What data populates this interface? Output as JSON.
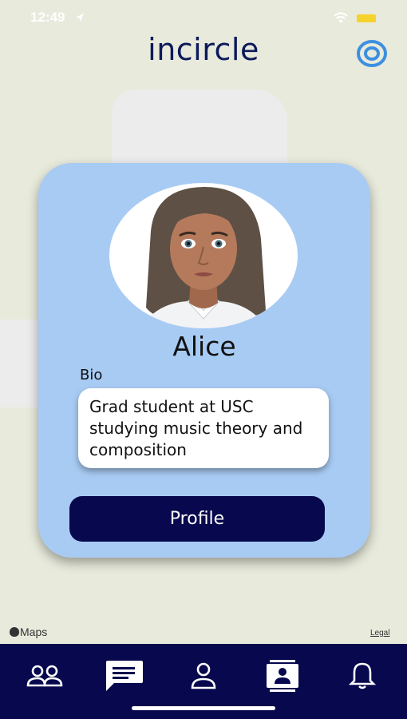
{
  "status_bar": {
    "time": "12:49"
  },
  "header": {
    "title": "incircle"
  },
  "card": {
    "name": "Alice",
    "bio_label": "Bio",
    "bio_text": "Grad student at USC studying music theory and composition",
    "profile_button": "Profile"
  },
  "map": {
    "attribution": "Maps",
    "legal": "Legal"
  },
  "tab_bar": {
    "items": [
      {
        "icon": "people-icon",
        "active": false
      },
      {
        "icon": "chat-icon",
        "active": true
      },
      {
        "icon": "person-icon",
        "active": false
      },
      {
        "icon": "contact-card-icon",
        "active": false
      },
      {
        "icon": "bell-icon",
        "active": false
      }
    ]
  },
  "colors": {
    "background": "#e8eadc",
    "brand_navy": "#07084d",
    "card_blue": "#a8cbf3",
    "accent_blue": "#3d8fe0"
  }
}
